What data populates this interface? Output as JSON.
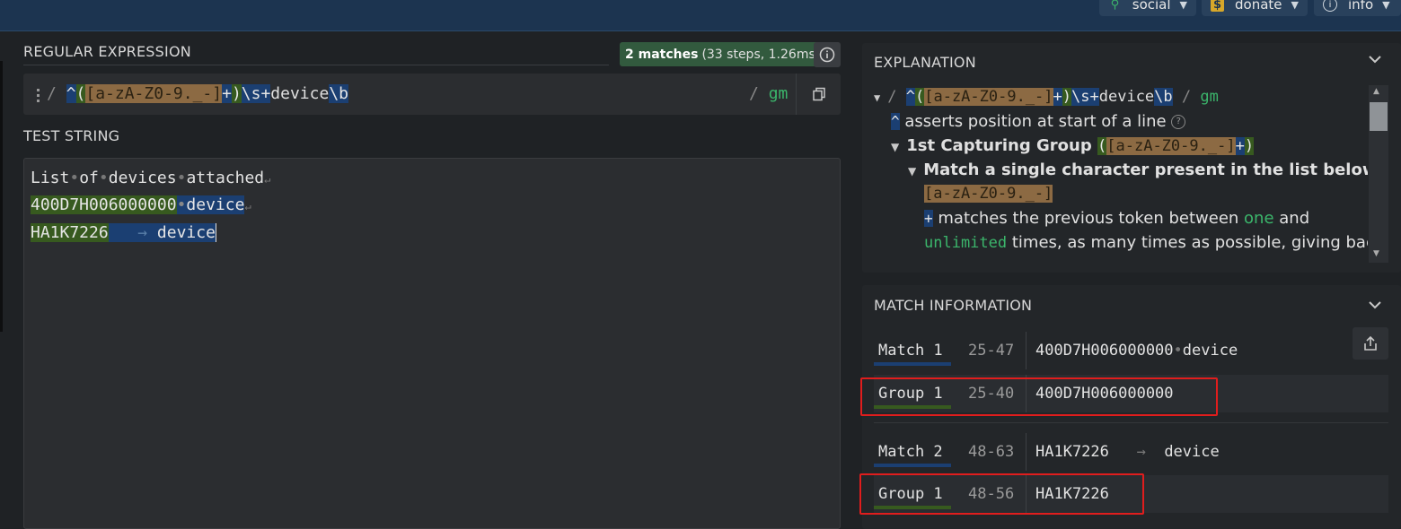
{
  "topbar": {
    "social_label": "social",
    "donate_label": "donate",
    "info_label": "info"
  },
  "regex": {
    "section_title": "REGULAR EXPRESSION",
    "matches_bold": "2 matches",
    "matches_detail": "(33 steps, 1.26ms)",
    "delimiter_open": "/",
    "caret": "^",
    "group_open": "(",
    "char_class": "[a-zA-Z0-9._-]",
    "plus": "+",
    "group_close": ")",
    "ws_token": "\\s+",
    "literal": "device",
    "boundary": "\\b",
    "delimiter_close": "/",
    "flags": "gm"
  },
  "test": {
    "section_title": "TEST STRING",
    "line1_words": [
      "List",
      "of",
      "devices",
      "attached"
    ],
    "line2_group": "400D7H006000000",
    "line2_rest": "device",
    "line3_group": "HA1K7226",
    "line3_rest": "device"
  },
  "explanation": {
    "section_title": "EXPLANATION",
    "row1_caret_desc": "asserts position at start of a line",
    "row2_label": "1st Capturing Group",
    "row3_label": "Match a single character present in the list below",
    "row5_prefix": "matches the previous token between",
    "row5_one": "one",
    "row5_and": "and",
    "row6_unlimited": "unlimited",
    "row6_rest": "times, as many times as possible, giving back"
  },
  "match_info": {
    "section_title": "MATCH INFORMATION",
    "rows": [
      {
        "label": "Match 1",
        "range": "25-47",
        "value_a": "400D7H006000000",
        "value_b": "device"
      },
      {
        "label": "Group 1",
        "range": "25-40",
        "value_a": "400D7H006000000",
        "value_b": ""
      },
      {
        "label": "Match 2",
        "range": "48-63",
        "value_a": "HA1K7226",
        "value_b": "device"
      },
      {
        "label": "Group 1",
        "range": "48-56",
        "value_a": "HA1K7226",
        "value_b": ""
      }
    ]
  },
  "colors": {
    "match_blue": "#1b3f72",
    "group_green": "#375a1f",
    "class_orange": "#8c6a43",
    "highlight_red": "#e01d1d"
  }
}
